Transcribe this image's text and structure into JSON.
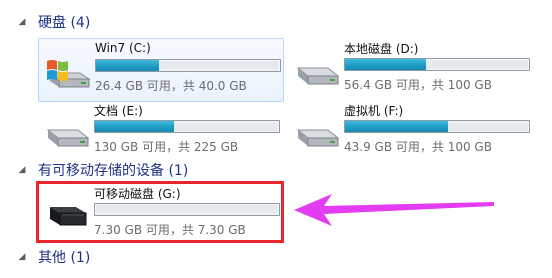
{
  "hard_disks": {
    "header": "硬盘 (4)",
    "drives": [
      {
        "name": "Win7 (C:)",
        "space": "26.4 GB 可用，共 40.0 GB",
        "used_fraction": 0.34,
        "icon": "windows-drive-icon"
      },
      {
        "name": "本地磁盘 (D:)",
        "space": "56.4 GB 可用，共 100 GB",
        "used_fraction": 0.44,
        "icon": "hard-drive-icon"
      },
      {
        "name": "文档 (E:)",
        "space": "130 GB 可用，共 225 GB",
        "used_fraction": 0.43,
        "icon": "hard-drive-icon"
      },
      {
        "name": "虚拟机 (F:)",
        "space": "43.9 GB 可用，共 100 GB",
        "used_fraction": 0.56,
        "icon": "hard-drive-icon"
      }
    ]
  },
  "removable": {
    "header": "有可移动存储的设备 (1)",
    "drives": [
      {
        "name": "可移动磁盘 (G:)",
        "space": "7.30 GB 可用，共 7.30 GB",
        "used_fraction": 0.0,
        "icon": "removable-drive-icon"
      }
    ]
  },
  "other": {
    "header": "其他 (1)"
  },
  "annotation": {
    "color": "#e5262c",
    "arrow_color": "#e43cf0"
  }
}
